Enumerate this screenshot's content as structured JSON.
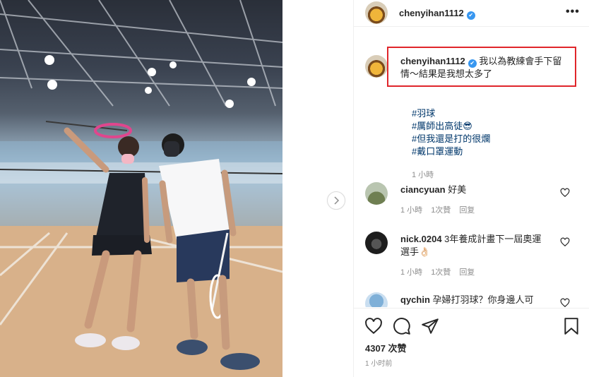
{
  "header": {
    "username": "chenyihan1112",
    "verified_mark": "✔",
    "more_icon": "ellipsis-icon"
  },
  "carousel": {
    "next_icon": "chevron-right-icon"
  },
  "caption": {
    "username": "chenyihan1112",
    "text": "我以為教練會手下留情～結果是我想太多了",
    "hashtags": [
      "#羽球",
      "#厲師出高徒😎",
      "#但我還是打的很爛",
      "#戴口罩運動"
    ],
    "time": "1 小時",
    "highlight_color": "#e0262b"
  },
  "comments": [
    {
      "username": "ciancyuan",
      "text": "好美",
      "time": "1 小時",
      "likes": "1次贊",
      "reply": "回复"
    },
    {
      "username": "nick.0204",
      "text": "3年養成計畫下一屆奧運選手👌🏻",
      "time": "1 小時",
      "likes": "1次贊",
      "reply": "回复"
    },
    {
      "username": "qychin",
      "text": "孕婦打羽球？你身邊人可",
      "time": "",
      "likes": "",
      "reply": ""
    }
  ],
  "actions": {
    "like_icon": "heart-icon",
    "comment_icon": "comment-icon",
    "share_icon": "share-icon",
    "save_icon": "bookmark-icon",
    "likes_count": "4307 次赞",
    "posted": "1 小时前"
  },
  "colors": {
    "link": "#00376b",
    "verified": "#3897f0",
    "muted": "#8e8e8e"
  }
}
